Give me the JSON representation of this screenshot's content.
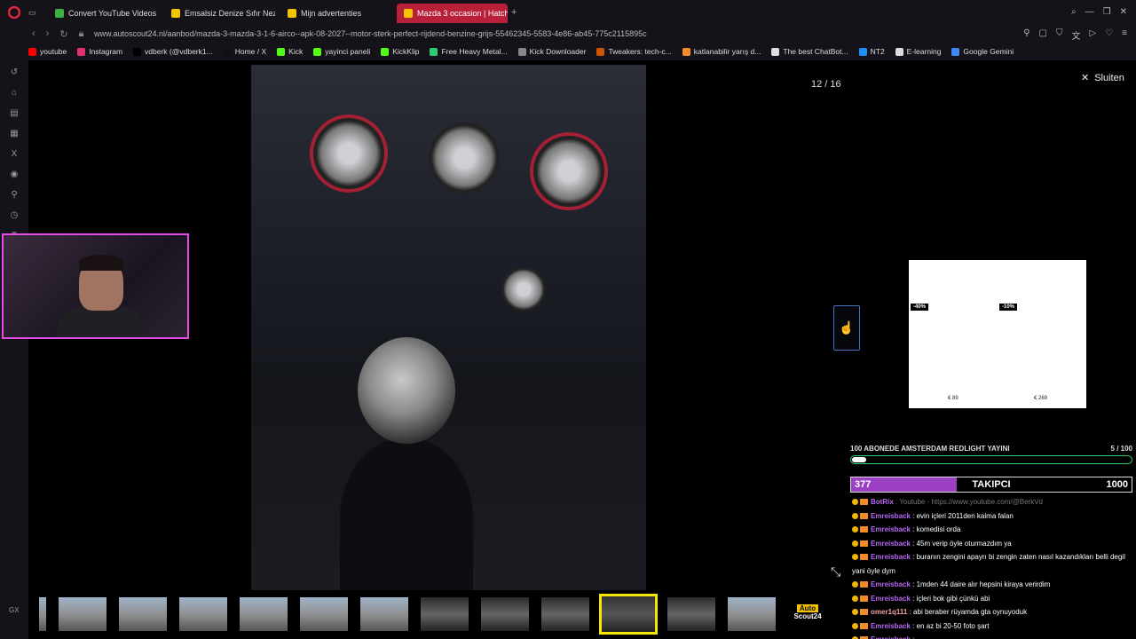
{
  "tabs": [
    {
      "label": "Convert YouTube Videos t",
      "color": "#3cb043"
    },
    {
      "label": "Emsalsiz Denize Sıfır Nez",
      "color": "#f4c400"
    },
    {
      "label": "Mijn advertenties",
      "color": "#f4c400"
    },
    {
      "label": "Mazda 3 occasion | Hatchb",
      "color": "#f4c400",
      "active": true
    }
  ],
  "address": {
    "url": "www.autoscout24.nl/aanbod/mazda-3-mazda-3-1-6-airco--apk-08-2027--motor-sterk-perfect-rijdend-benzine-grijs-55462345-5583-4e86-ab45-775c2115895c"
  },
  "bookmarks": [
    {
      "label": "youtube",
      "color": "#ff0000"
    },
    {
      "label": "Instagram",
      "color": "#e1306c"
    },
    {
      "label": "vdberk (@vdberk1...",
      "color": "#000000"
    },
    {
      "label": "Home / X",
      "color": "#111111"
    },
    {
      "label": "Kick",
      "color": "#53fc18"
    },
    {
      "label": "yayinci paneli",
      "color": "#53fc18"
    },
    {
      "label": "KickKlip",
      "color": "#53fc18"
    },
    {
      "label": "Free Heavy Metal...",
      "color": "#2ecc71"
    },
    {
      "label": "Kick Downloader",
      "color": "#888888"
    },
    {
      "label": "Tweakers: tech-c...",
      "color": "#cc5500"
    },
    {
      "label": "katlanabilir yarış d...",
      "color": "#f28c28"
    },
    {
      "label": "The best ChatBot...",
      "color": "#dddddd"
    },
    {
      "label": "NT2",
      "color": "#1e90ff"
    },
    {
      "label": "E-learning",
      "color": "#dddddd"
    },
    {
      "label": "Google Gemini",
      "color": "#4285f4"
    }
  ],
  "viewer": {
    "counter": "12 / 16",
    "close_label": "Sluiten"
  },
  "ad": {
    "disc1": "-40%",
    "disc2": "-10%",
    "price1": "€ 89",
    "price2": "€ 269"
  },
  "goal": {
    "title": "100 ABONEDE AMSTERDAM REDLIGHT YAYINI",
    "progress": "5  / 100",
    "fraction": 0.05
  },
  "followers": {
    "current": "377",
    "label": "TAKIPCI",
    "target": "1000",
    "fraction": 0.377
  },
  "chat": [
    {
      "user": "BotRix",
      "text": " : Youtube - https://www.youtube.com/@BerkVd",
      "faded": true
    },
    {
      "user": "Emreisback",
      "text": " : evin içleri 2011den kalma falan"
    },
    {
      "user": "Emreisback",
      "text": " : komedisi orda"
    },
    {
      "user": "Emreisback",
      "text": " : 45m verip öyle oturmazdım ya"
    },
    {
      "user": "Emreisback",
      "text": " : buranın zengini apayrı bi zengin zaten nasıl kazandıkları belli degil yani öyle dym"
    },
    {
      "user": "Emreisback",
      "text": " : 1mden 44 daire alır hepsini kiraya verirdim"
    },
    {
      "user": "Emreisback",
      "text": " : içleri bok gibi çünkü abi"
    },
    {
      "user": "omer1q111",
      "text": " : abi beraber rüyamda gta oynuyoduk",
      "alt": true
    },
    {
      "user": "Emreisback",
      "text": " : en az bi 20-50 foto şart"
    },
    {
      "user": "Emreisback",
      "text": " : "
    }
  ],
  "logo": {
    "line1": "Auto",
    "line2": "Scout24"
  },
  "sidebar_label": "GX"
}
